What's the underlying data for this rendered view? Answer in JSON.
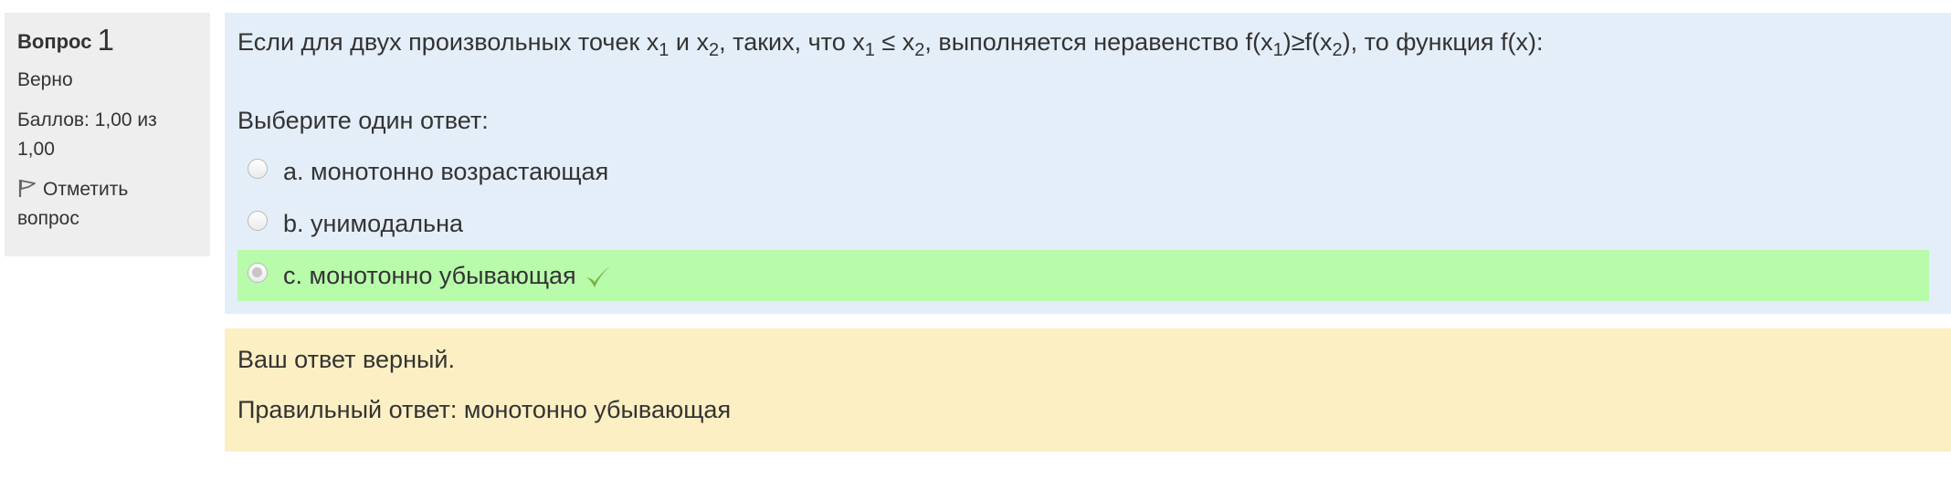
{
  "info": {
    "question_label": "Вопрос",
    "question_number": "1",
    "state": "Верно",
    "grade_line1": "Баллов: 1,00 из",
    "grade_line2": "1,00",
    "flag_line1": "Отметить",
    "flag_line2": "вопрос",
    "flag_icon": "flag-icon"
  },
  "question": {
    "t1": "Если для двух произвольных точек x",
    "s1": "1",
    "t2": " и x",
    "s2": "2",
    "t3": ", таких, что x",
    "s3": "1",
    "t4": " ≤ x",
    "s4": "2",
    "t5": ", выполняется неравенство f(x",
    "s5": "1",
    "t6": ")≥f(x",
    "s6": "2",
    "t7": "), то функция f(x):",
    "prompt": "Выберите один ответ:"
  },
  "answers": [
    {
      "label": "a. монотонно возрастающая",
      "checked": false,
      "correct": false
    },
    {
      "label": "b. унимодальна",
      "checked": false,
      "correct": false
    },
    {
      "label": "c. монотонно убывающая",
      "checked": true,
      "correct": true
    }
  ],
  "outcome": {
    "feedback": "Ваш ответ верный.",
    "right_answer": "Правильный ответ: монотонно убывающая"
  },
  "colors": {
    "info_bg": "#eeeeee",
    "formulation_bg": "#e4eef9",
    "correct_bg": "#b8fbab",
    "outcome_bg": "#fcefc3",
    "check": "#7cb342"
  }
}
